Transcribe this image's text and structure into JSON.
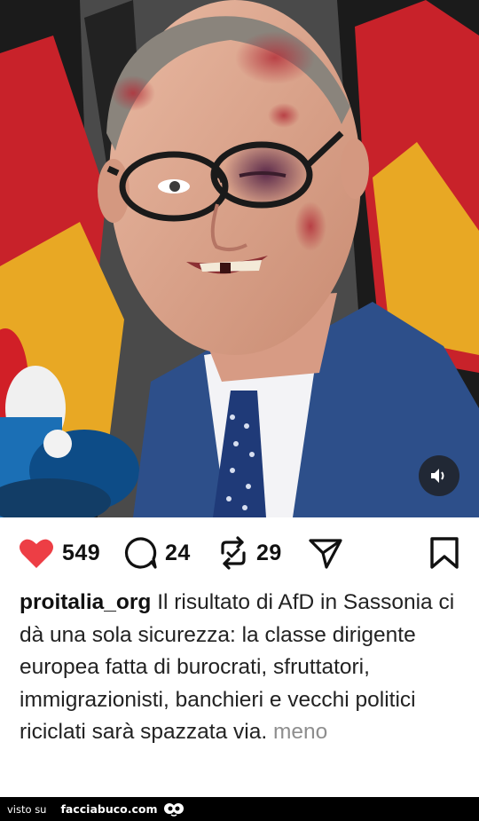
{
  "post": {
    "image_alt": "",
    "likes": "549",
    "comments": "24",
    "reposts": "29",
    "username": "proitalia_org",
    "caption": "Il risultato di AfD in Sassonia ci dà una sola sicurezza: la classe dirigente europea fatta di burocrati, sfruttatori, immigrazionisti, banchieri e vecchi politici riciclati sarà spazzata via.",
    "more_label": "meno"
  },
  "icons": {
    "like": "heart-filled-icon",
    "comment": "speech-bubble-icon",
    "repost": "repost-arrows-icon",
    "share": "paper-plane-icon",
    "save": "bookmark-icon",
    "sound": "speaker-icon"
  },
  "colors": {
    "like": "#ed3e45",
    "caption_more": "#8e8e8e",
    "flag_black": "#1b1b1b",
    "flag_red": "#c8222a",
    "flag_gold": "#e8a824",
    "suit": "#2d4f8a"
  },
  "footer": {
    "visto_label": "visto su",
    "site_label": "facciabuco.com"
  }
}
